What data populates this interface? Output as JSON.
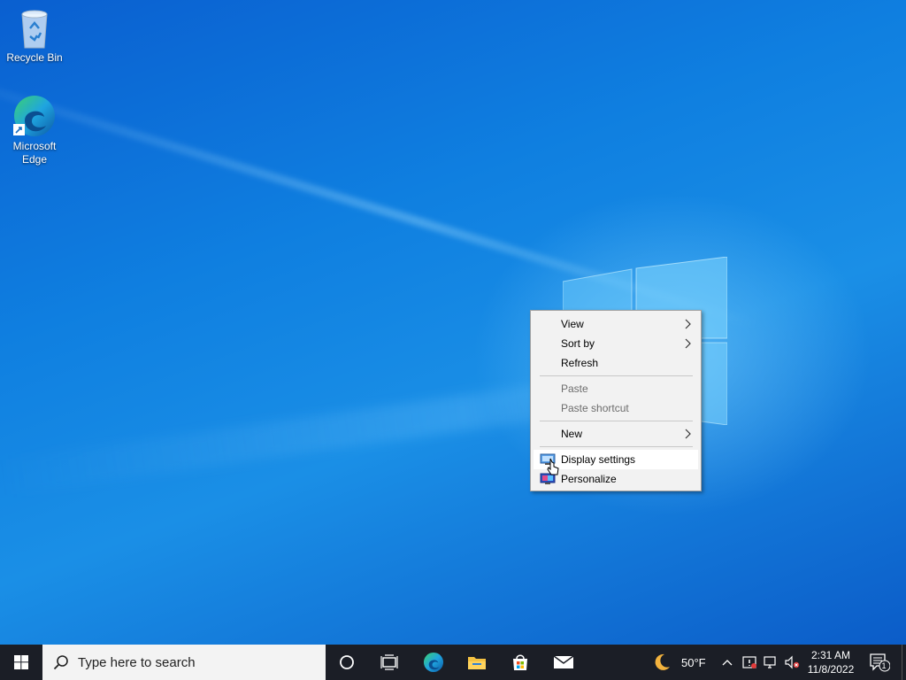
{
  "desktop": {
    "icons": [
      {
        "label": "Recycle Bin",
        "icon": "recycle-bin-icon"
      },
      {
        "label": "Microsoft Edge",
        "icon": "edge-icon"
      }
    ]
  },
  "context_menu": {
    "items": [
      {
        "label": "View",
        "submenu": true
      },
      {
        "label": "Sort by",
        "submenu": true
      },
      {
        "label": "Refresh"
      },
      {
        "label": "Paste",
        "disabled": true
      },
      {
        "label": "Paste shortcut",
        "disabled": true
      },
      {
        "label": "New",
        "submenu": true
      },
      {
        "label": "Display settings",
        "icon": "display-settings-icon",
        "highlighted": true
      },
      {
        "label": "Personalize",
        "icon": "personalize-icon"
      }
    ]
  },
  "taskbar": {
    "search_placeholder": "Type here to search",
    "pinned": [
      "cortana-icon",
      "task-view-icon",
      "edge-icon",
      "file-explorer-icon",
      "microsoft-store-icon",
      "mail-icon"
    ],
    "weather": {
      "temp": "50°F",
      "icon": "moon-icon"
    },
    "clock": {
      "time": "2:31 AM",
      "date": "11/8/2022"
    },
    "notifications_count": "1"
  },
  "colors": {
    "accent": "#0078d7",
    "taskbar": "#1b1e26"
  }
}
